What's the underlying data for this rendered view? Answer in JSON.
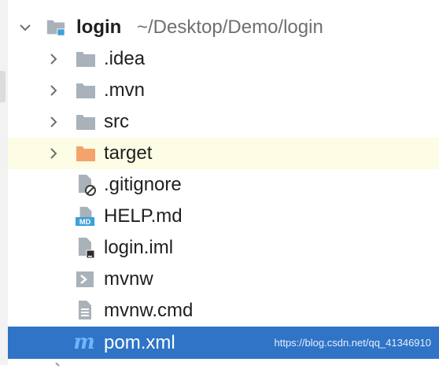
{
  "root": {
    "label": "login",
    "path": "~/Desktop/Demo/login",
    "icon": "module-folder-icon",
    "expanded": true
  },
  "items": [
    {
      "label": ".idea",
      "type": "folder",
      "icon": "folder-icon",
      "color": "#a9b1b9"
    },
    {
      "label": ".mvn",
      "type": "folder",
      "icon": "folder-icon",
      "color": "#a9b1b9"
    },
    {
      "label": "src",
      "type": "folder",
      "icon": "folder-icon",
      "color": "#a9b1b9"
    },
    {
      "label": "target",
      "type": "folder",
      "icon": "excluded-folder-icon",
      "color": "#f4a46b",
      "highlighted": true
    },
    {
      "label": ".gitignore",
      "type": "file",
      "icon": "ignored-file-icon"
    },
    {
      "label": "HELP.md",
      "type": "file",
      "icon": "markdown-file-icon",
      "badge": "MD"
    },
    {
      "label": "login.iml",
      "type": "file",
      "icon": "iml-file-icon"
    },
    {
      "label": "mvnw",
      "type": "file",
      "icon": "shell-script-icon"
    },
    {
      "label": "mvnw.cmd",
      "type": "file",
      "icon": "text-file-icon"
    },
    {
      "label": "pom.xml",
      "type": "file",
      "icon": "maven-icon",
      "badge": "m",
      "selected": true
    }
  ],
  "watermark": "https://blog.csdn.net/qq_41346910",
  "colors": {
    "selection": "#2f74c6",
    "highlight": "#fdfde6",
    "folder": "#a9b1b9",
    "excluded_folder": "#f4a46b",
    "maven": "#3f8fe0",
    "markdown": "#3fa0d8"
  }
}
